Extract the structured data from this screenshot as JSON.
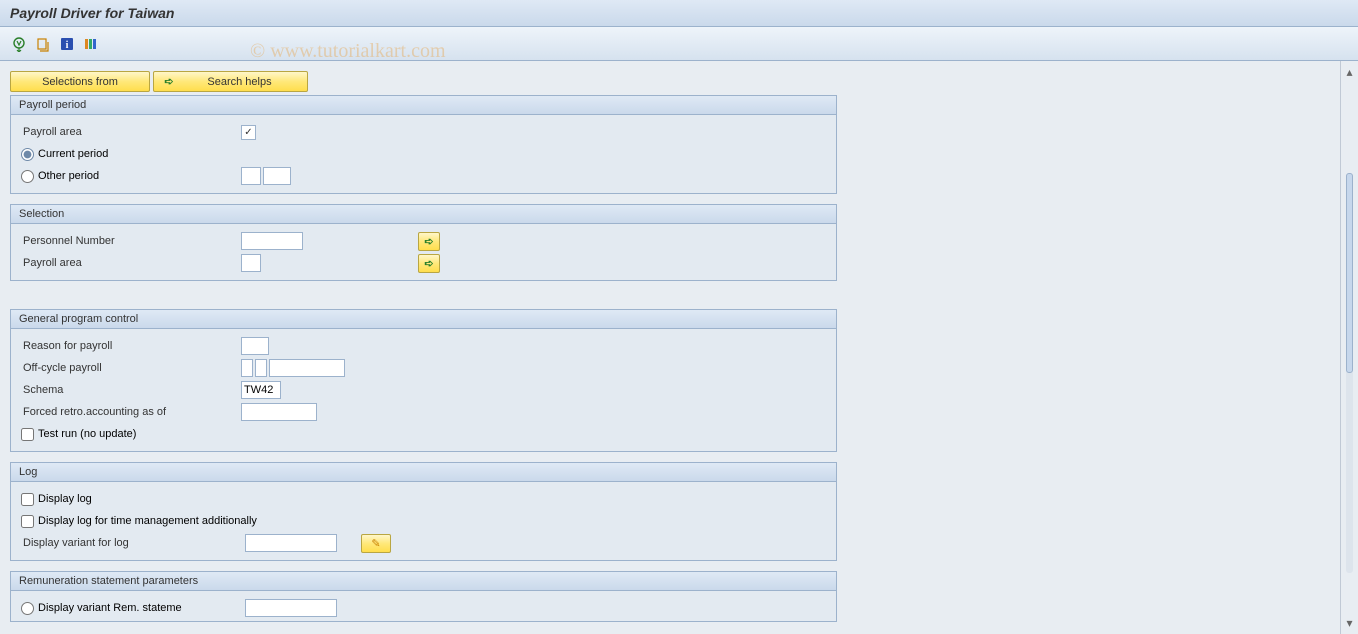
{
  "title": "Payroll Driver for Taiwan",
  "watermark": "© www.tutorialkart.com",
  "top_buttons": {
    "selections_from": "Selections from",
    "search_helps": "Search helps"
  },
  "groups": {
    "payroll_period": {
      "title": "Payroll period",
      "payroll_area_label": "Payroll area",
      "current_period": "Current period",
      "other_period": "Other period"
    },
    "selection": {
      "title": "Selection",
      "personnel_number": "Personnel Number",
      "payroll_area": "Payroll area"
    },
    "general": {
      "title": "General program control",
      "reason": "Reason for payroll",
      "off_cycle": "Off-cycle payroll",
      "schema": "Schema",
      "schema_value": "TW42",
      "forced_retro": "Forced retro.accounting as of",
      "test_run": "Test run (no update)"
    },
    "log": {
      "title": "Log",
      "display_log": "Display log",
      "display_log_time": "Display log for time management additionally",
      "display_variant": "Display variant for log"
    },
    "remuneration": {
      "title": "Remuneration statement parameters",
      "display_variant_rem": "Display variant Rem. stateme"
    }
  }
}
